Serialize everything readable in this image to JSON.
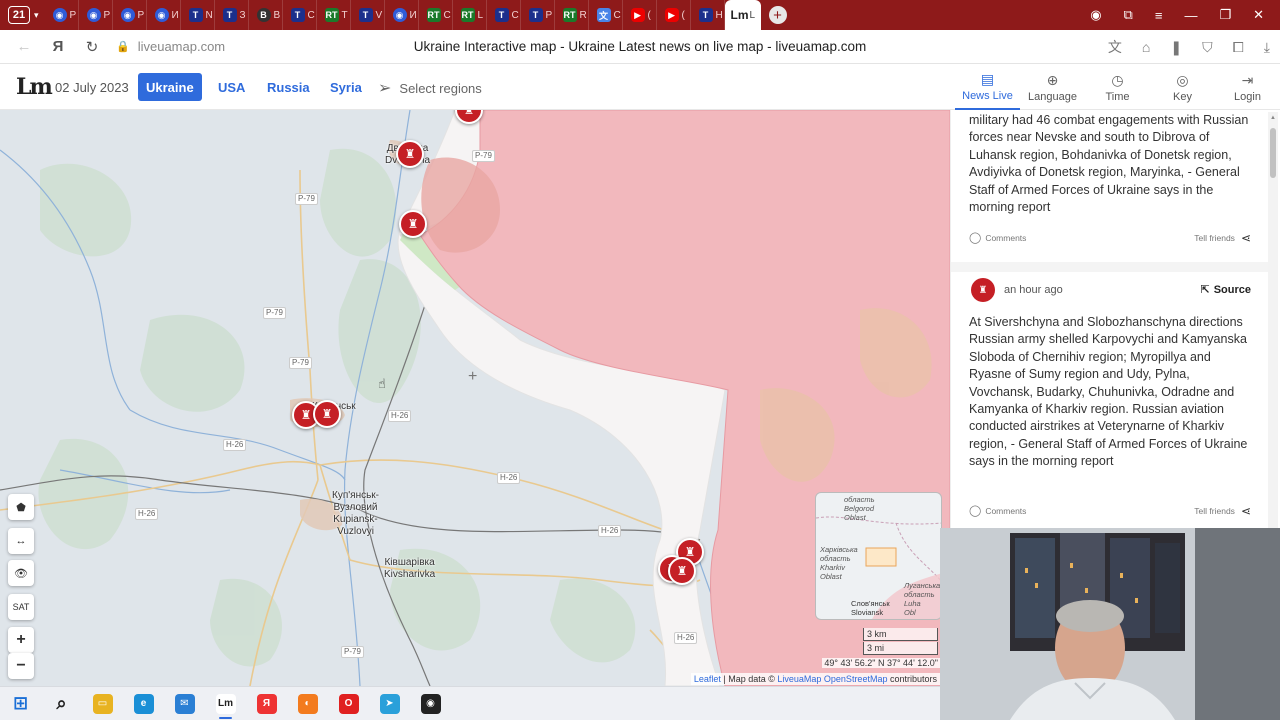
{
  "browser": {
    "tab_count": "21",
    "tabs": [
      {
        "icon": "rss",
        "label": "Р"
      },
      {
        "icon": "rss",
        "label": "Р"
      },
      {
        "icon": "rss",
        "label": "Р"
      },
      {
        "icon": "rss",
        "label": "И"
      },
      {
        "icon": "tg",
        "label": "N"
      },
      {
        "icon": "tg",
        "label": "З"
      },
      {
        "icon": "bbc",
        "label": "В"
      },
      {
        "icon": "tg",
        "label": "С"
      },
      {
        "icon": "rt",
        "label": "Т"
      },
      {
        "icon": "tg",
        "label": "V"
      },
      {
        "icon": "rss",
        "label": "И"
      },
      {
        "icon": "rt",
        "label": "С"
      },
      {
        "icon": "rt",
        "label": "L"
      },
      {
        "icon": "tg",
        "label": "С"
      },
      {
        "icon": "tg",
        "label": "Р"
      },
      {
        "icon": "rt",
        "label": "R"
      },
      {
        "icon": "gt",
        "label": "С"
      },
      {
        "icon": "yt",
        "label": "("
      },
      {
        "icon": "yt",
        "label": "("
      },
      {
        "icon": "tg",
        "label": "Н"
      },
      {
        "icon": "lv",
        "label": "L"
      }
    ],
    "host": "liveuamap.com",
    "page_title": "Ukraine Interactive map - Ukraine Latest news on live map - liveuamap.com"
  },
  "header": {
    "logo": "Lm",
    "date": "02 July 2023",
    "regions": [
      "Ukraine",
      "USA",
      "Russia",
      "Syria"
    ],
    "active_region": "Ukraine",
    "select_regions": "Select regions",
    "right_nav": [
      {
        "label": "News Live",
        "icon": "news-icon"
      },
      {
        "label": "Language",
        "icon": "language-icon"
      },
      {
        "label": "Time",
        "icon": "clock-icon"
      },
      {
        "label": "Key",
        "icon": "key-icon"
      },
      {
        "label": "Login",
        "icon": "login-icon"
      }
    ]
  },
  "map": {
    "roads": [
      "P-79",
      "P-79",
      "P-79",
      "P-79",
      "H-26",
      "H-26",
      "H-26",
      "H-26",
      "H-26",
      "H-26",
      "P-79"
    ],
    "towns": {
      "dvorichna": "Дворічна\nDvorichna",
      "kupiansk": "Куп'янськ",
      "kup_vuzlovyi": "Куп'янськ-\nВузловий\nKupiansk-\nVuzlovyi",
      "kivsharivka": "Ківшарівка\nKivsharivka"
    },
    "controls": [
      "⬟",
      "↔",
      "👁",
      "SAT",
      "+",
      "−"
    ],
    "minimap": {
      "belgorod": "область\nBelgorod\nOblast",
      "kharkiv": "Харківська\nобласть\nKharkiv\nOblast",
      "luhansk": "Луганська\nобласть\nLuha\nObl",
      "sloviansk": "Слов'янськ\nSloviansk"
    },
    "scale": {
      "km": "3 km",
      "mi": "3 mi"
    },
    "coords": "49° 43' 56.2\" N 37° 44' 12.0\"",
    "attribution": {
      "leaflet": "Leaflet",
      "text": " | Map data © ",
      "link": "LiveuaMap OpenStreetMap",
      "suffix": " contributors"
    }
  },
  "news": {
    "items": [
      {
        "text": "military had 46 combat engagements with Russian forces near Nevske and south to Dibrova of Luhansk region, Bohdanivka of Donetsk region, Avdiyivka of Donetsk region, Maryinka, - General Staff of Armed Forces of Ukraine says in the morning report",
        "comments": "Comments",
        "tell_friends": "Tell friends"
      },
      {
        "time": "an hour ago",
        "source": "Source",
        "text": "At Sivershchyna and Slobozhanschyna directions Russian army shelled Karpovychi and Kamyanska Sloboda of Chernihiv region; Myropillya and Ryasne of Sumy region and Udy, Pylna, Vovchansk, Budarky, Chuhunivka, Odradne and Kamyanka of Kharkiv region. Russian aviation conducted airstrikes at Veterynarne of Kharkiv region, - General Staff of Armed Forces of Ukraine says in the morning report",
        "comments": "Comments",
        "tell_friends": "Tell friends"
      }
    ]
  },
  "taskbar": [
    {
      "icon": "windows-icon",
      "color": "#1a6fd6"
    },
    {
      "icon": "search-icon",
      "color": "#222"
    },
    {
      "icon": "file-explorer-icon",
      "color": "#e8b321"
    },
    {
      "icon": "edge-icon",
      "color": "#1a8fd6"
    },
    {
      "icon": "mail-icon",
      "color": "#2a7fd4"
    },
    {
      "icon": "liveuamap-app-icon",
      "color": "#fff"
    },
    {
      "icon": "yandex-browser-icon",
      "color": "#e33"
    },
    {
      "icon": "firefox-icon",
      "color": "#f37b1e"
    },
    {
      "icon": "opera-icon",
      "color": "#e02020"
    },
    {
      "icon": "telegram-icon",
      "color": "#2aa0da"
    },
    {
      "icon": "obs-icon",
      "color": "#222"
    }
  ],
  "colors": {
    "russian_control": "#f2b8bd",
    "contested": "#f7f4f4",
    "marker": "#c51f25",
    "accent": "#2f6bdc",
    "tabstrip": "#8e1a1a"
  }
}
